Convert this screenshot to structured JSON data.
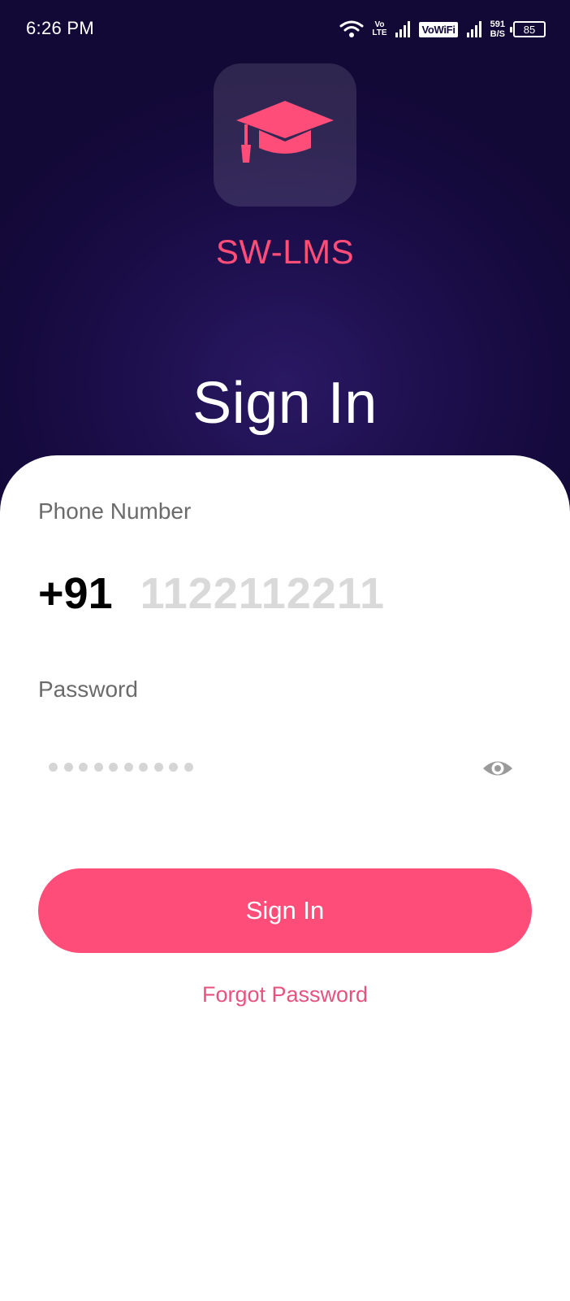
{
  "status_bar": {
    "time": "6:26 PM",
    "volte_top": "Vo",
    "volte_bottom": "LTE",
    "vowifi": "VoWiFi",
    "speed_value": "591",
    "speed_unit": "B/S",
    "battery": "85"
  },
  "app": {
    "name": "SW-LMS",
    "logo_icon": "graduation-cap-icon"
  },
  "hero": {
    "title": "Sign In"
  },
  "form": {
    "phone_label": "Phone Number",
    "country_code": "+91",
    "phone_placeholder": "1122112211",
    "password_label": "Password",
    "password_masked_length": 10,
    "toggle_icon": "eye-icon",
    "submit_label": "Sign In",
    "forgot_label": "Forgot Password"
  },
  "colors": {
    "background_dark": "#130937",
    "accent": "#ff4d79",
    "card": "#ffffff"
  }
}
